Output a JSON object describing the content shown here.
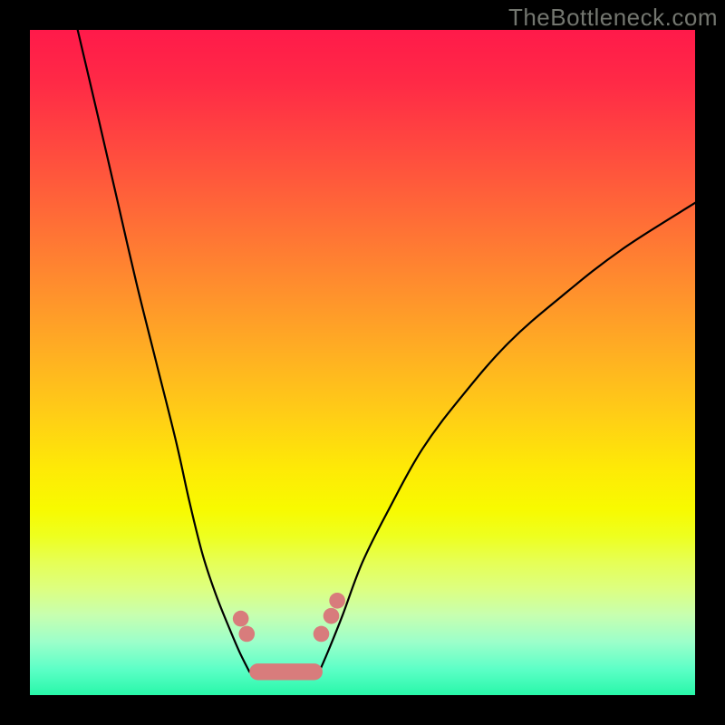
{
  "watermark": "TheBottleneck.com",
  "colors": {
    "marker": "#d87c7c",
    "curve": "#000000"
  },
  "chart_data": {
    "type": "line",
    "title": "",
    "xlabel": "",
    "ylabel": "",
    "xlim": [
      0,
      100
    ],
    "ylim": [
      0,
      100
    ],
    "grid": false,
    "note": "Values are approximate positions in percent of plot area; y measured from top (0=top, 100=bottom).",
    "series": [
      {
        "name": "left-branch",
        "x": [
          6,
          10,
          13,
          16,
          19,
          22,
          24,
          26,
          28,
          30,
          31.5,
          33
        ],
        "y": [
          -5,
          12,
          25,
          38,
          50,
          62,
          71,
          79,
          85,
          90,
          93.5,
          96.5
        ]
      },
      {
        "name": "right-branch",
        "x": [
          43.5,
          45,
          47,
          50,
          54,
          59,
          65,
          72,
          80,
          89,
          100
        ],
        "y": [
          96.5,
          93,
          88,
          80,
          72,
          63,
          55,
          47,
          40,
          33,
          26
        ]
      }
    ],
    "markers": [
      {
        "x": 31.7,
        "y": 88.5,
        "r": 1.2
      },
      {
        "x": 32.6,
        "y": 90.8,
        "r": 1.2
      },
      {
        "x": 43.8,
        "y": 90.8,
        "r": 1.2
      },
      {
        "x": 45.3,
        "y": 88.1,
        "r": 1.2
      },
      {
        "x": 46.2,
        "y": 85.8,
        "r": 1.2
      }
    ],
    "valley_segment": {
      "x0": 33.0,
      "y0": 96.5,
      "x1": 44.0,
      "y1": 96.5,
      "thickness_pct": 2.5
    }
  }
}
